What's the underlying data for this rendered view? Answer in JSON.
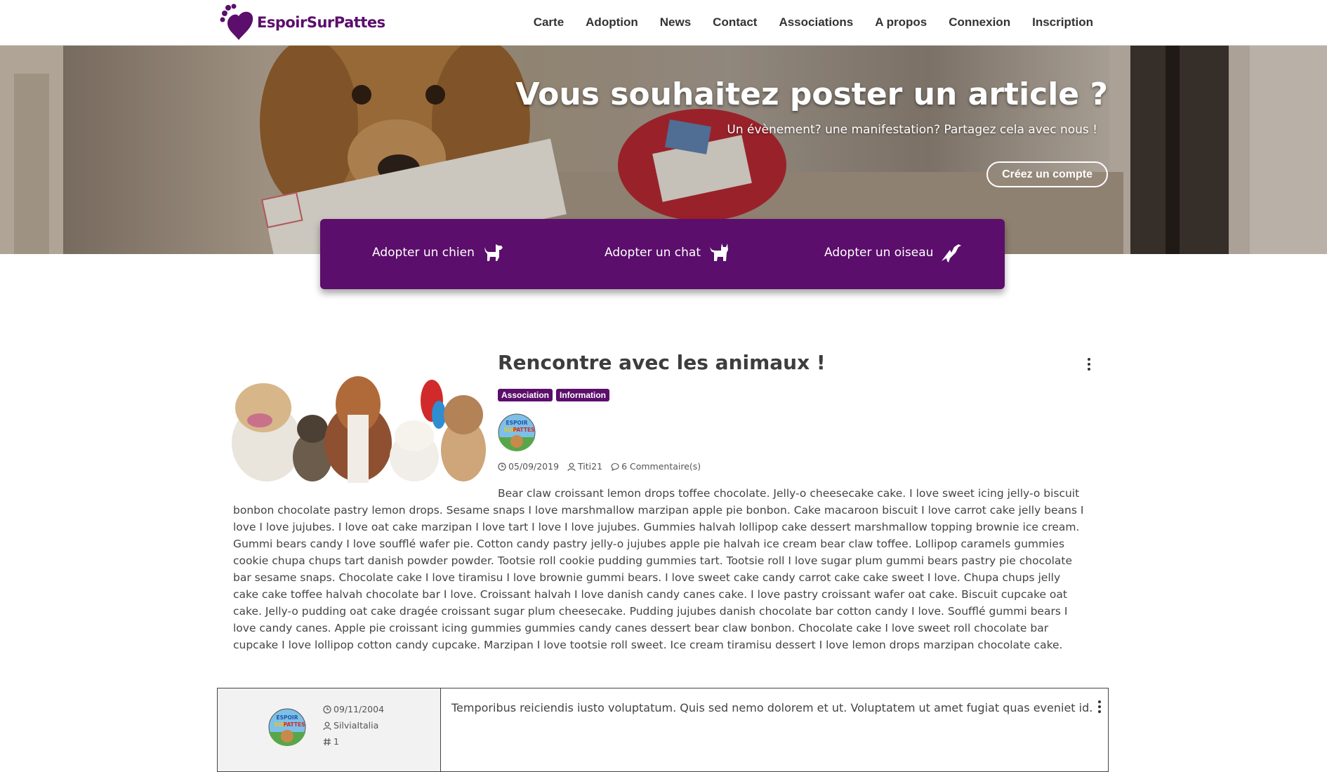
{
  "brand": {
    "name": "EspoirSurPattes",
    "color": "#5b0e6b"
  },
  "nav": {
    "items": [
      "Carte",
      "Adoption",
      "News",
      "Contact",
      "Associations",
      "A propos",
      "Connexion",
      "Inscription"
    ]
  },
  "hero": {
    "title": "Vous souhaitez poster un article ?",
    "subtitle": "Un évènement? une manifestation? Partagez cela avec nous !",
    "cta": "Créez un compte"
  },
  "adopt": {
    "dog": {
      "label": "Adopter un chien",
      "icon": "dog-icon"
    },
    "cat": {
      "label": "Adopter un chat",
      "icon": "cat-icon"
    },
    "bird": {
      "label": "Adopter un oiseau",
      "icon": "bird-icon"
    }
  },
  "article": {
    "title": "Rencontre avec les animaux !",
    "tags": [
      "Association",
      "Information"
    ],
    "date": "05/09/2019",
    "author": "Titi21",
    "comments": "6 Commentaire(s)",
    "body": "Bear claw croissant lemon drops toffee chocolate. Jelly-o cheesecake cake. I love sweet icing jelly-o biscuit bonbon chocolate pastry lemon drops. Sesame snaps I love marshmallow marzipan apple pie bonbon. Cake macaroon biscuit I love carrot cake jelly beans I love I love jujubes. I love oat cake marzipan I love tart I love I love jujubes. Gummies halvah lollipop cake dessert marshmallow topping brownie ice cream. Gummi bears candy I love soufflé wafer pie. Cotton candy pastry jelly-o jujubes apple pie halvah ice cream bear claw toffee. Lollipop caramels gummies cookie chupa chups tart danish powder powder. Tootsie roll cookie pudding gummies tart. Tootsie roll I love sugar plum gummi bears pastry pie chocolate bar sesame snaps. Chocolate cake I love tiramisu I love brownie gummi bears. I love sweet cake candy carrot cake cake sweet I love. Chupa chups jelly cake cake toffee halvah chocolate bar I love. Croissant halvah I love danish candy canes cake. I love pastry croissant wafer oat cake. Biscuit cupcake oat cake. Jelly-o pudding oat cake dragée croissant sugar plum cheesecake. Pudding jujubes danish chocolate bar cotton candy I love. Soufflé gummi bears I love candy canes. Apple pie croissant icing gummies gummies candy canes dessert bear claw bonbon. Chocolate cake I love sweet roll chocolate bar cupcake I love lollipop cotton candy cupcake. Marzipan I love tootsie roll sweet. Ice cream tiramisu dessert I love lemon drops marzipan chocolate cake."
  },
  "comment": {
    "date": "09/11/2004",
    "author": "SilviaItalia",
    "number": "1",
    "text": "Temporibus reiciendis iusto voluptatum. Quis sed nemo dolorem et ut. Voluptatem ut amet fugiat quas eveniet id."
  },
  "avatar_logo": {
    "line1": "ESPOIR",
    "line2": "SUR",
    "line3": "PATTES"
  }
}
